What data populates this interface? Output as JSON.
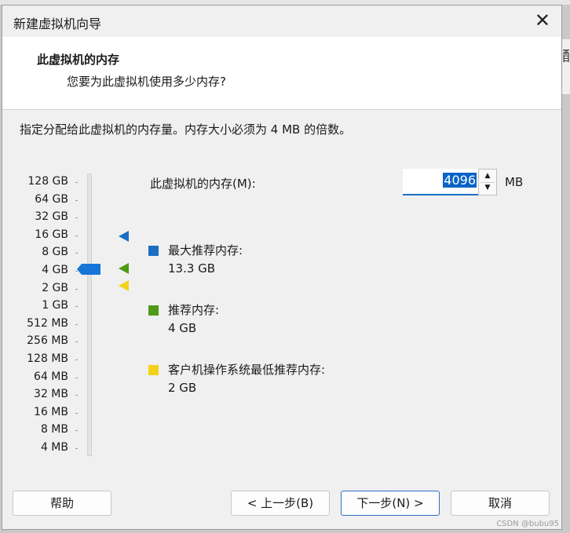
{
  "dialog": {
    "title": "新建虚拟机向导"
  },
  "header": {
    "title": "此虚拟机的内存",
    "subtitle": "您要为此虚拟机使用多少内存?"
  },
  "description": "指定分配给此虚拟机的内存量。内存大小必须为 4 MB 的倍数。",
  "scale": {
    "labels": [
      "128 GB",
      "64 GB",
      "32 GB",
      "16 GB",
      "8 GB",
      "4 GB",
      "2 GB",
      "1 GB",
      "512 MB",
      "256 MB",
      "128 MB",
      "64 MB",
      "32 MB",
      "16 MB",
      "8 MB",
      "4 MB"
    ],
    "current": "4 GB"
  },
  "memory": {
    "label": "此虚拟机的内存(M):",
    "value": "4096",
    "unit": "MB"
  },
  "legend": {
    "max": {
      "label": "最大推荐内存:",
      "value": "13.3 GB",
      "color": "#1a6fc2"
    },
    "recommended": {
      "label": "推荐内存:",
      "value": "4 GB",
      "color": "#4f9a16"
    },
    "minimum": {
      "label": "客户机操作系统最低推荐内存:",
      "value": "2 GB",
      "color": "#f2d21b"
    }
  },
  "buttons": {
    "help": "帮助",
    "back": "< 上一步(B)",
    "next": "下一步(N) >",
    "cancel": "取消"
  },
  "background": {
    "right_char": "配"
  },
  "watermark": "CSDN @bubu95"
}
